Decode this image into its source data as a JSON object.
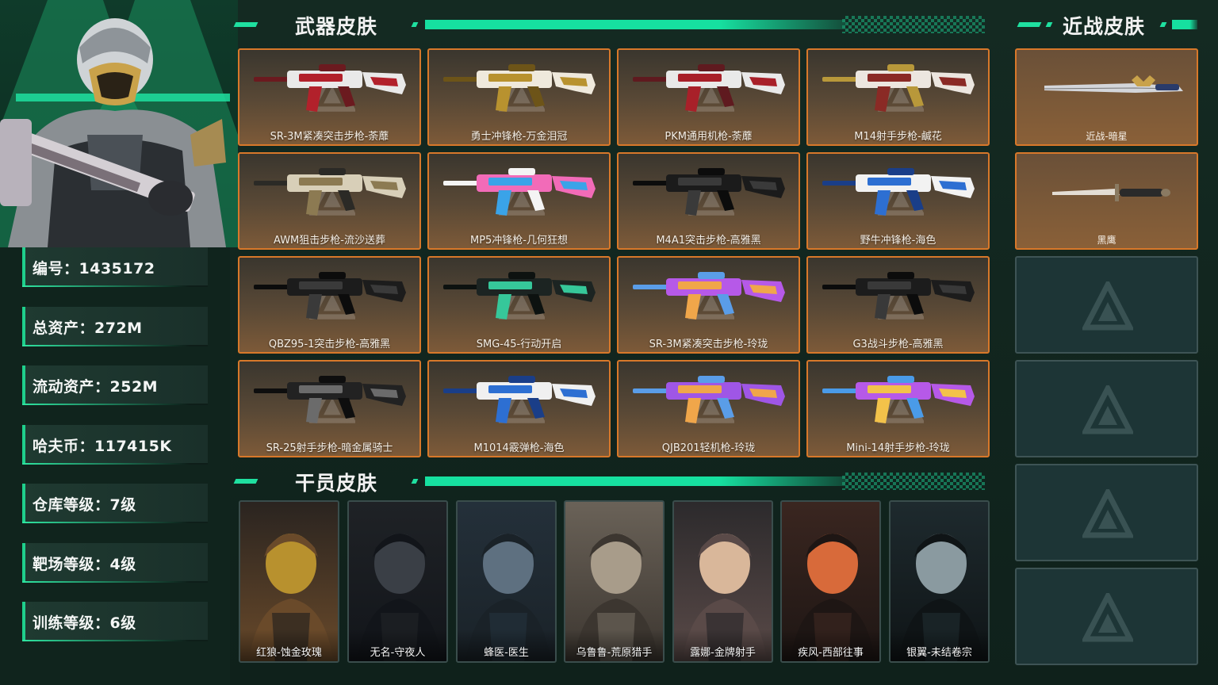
{
  "profile": {
    "stats": [
      {
        "label": "编号：1435172"
      },
      {
        "label": "总资产：272M"
      },
      {
        "label": "流动资产：252M"
      },
      {
        "label": "哈夫币：117415K"
      },
      {
        "label": "仓库等级：7级"
      },
      {
        "label": "靶场等级：4级"
      },
      {
        "label": "训练等级：6级"
      }
    ]
  },
  "sections": {
    "weapons_title": "武器皮肤",
    "operators_title": "干员皮肤",
    "melee_title": "近战皮肤"
  },
  "weapons": [
    {
      "name": "SR-3M紧凑突击步枪-荼蘼",
      "palette": [
        "#e9e9e9",
        "#b2212b",
        "#6b1a1f"
      ]
    },
    {
      "name": "勇士冲锋枪-万金泪冠",
      "palette": [
        "#efe9dc",
        "#b8922f",
        "#6d5418"
      ]
    },
    {
      "name": "PKM通用机枪-荼蘼",
      "palette": [
        "#e9e9e9",
        "#a82029",
        "#5f1a1f"
      ]
    },
    {
      "name": "M14射手步枪-鹹花",
      "palette": [
        "#ece6df",
        "#8a2a25",
        "#b8983a"
      ]
    },
    {
      "name": "AWM狙击步枪-流沙送葬",
      "palette": [
        "#d8cfb8",
        "#8c7a52",
        "#2b2a26"
      ]
    },
    {
      "name": "MP5冲锋枪-几何狂想",
      "palette": [
        "#f26bb8",
        "#3aa3e8",
        "#f4f4f4"
      ]
    },
    {
      "name": "M4A1突击步枪-高雅黑",
      "palette": [
        "#1b1b1b",
        "#3a3a3a",
        "#0c0c0c"
      ]
    },
    {
      "name": "野牛冲锋枪-海色",
      "palette": [
        "#f2f2f2",
        "#2d6fd2",
        "#1a3e88"
      ]
    },
    {
      "name": "QBZ95-1突击步枪-高雅黑",
      "palette": [
        "#1c1c1c",
        "#3a3a3a",
        "#0c0c0c"
      ]
    },
    {
      "name": "SMG-45-行动开启",
      "palette": [
        "#1c2422",
        "#36c79a",
        "#0d1210"
      ]
    },
    {
      "name": "SR-3M紧凑突击步枪-玲珑",
      "palette": [
        "#b659e8",
        "#f0a64a",
        "#5a9de8"
      ]
    },
    {
      "name": "G3战斗步枪-高雅黑",
      "palette": [
        "#1c1c1c",
        "#393939",
        "#0c0c0c"
      ]
    },
    {
      "name": "SR-25射手步枪-暗金属骑士",
      "palette": [
        "#222222",
        "#6b6b6b",
        "#0e0e0e"
      ]
    },
    {
      "name": "M1014霰弹枪-海色",
      "palette": [
        "#f0f0f0",
        "#2d6fd2",
        "#1a3e88"
      ]
    },
    {
      "name": "QJB201轻机枪-玲珑",
      "palette": [
        "#9f56e6",
        "#f0a64a",
        "#5a9de8"
      ]
    },
    {
      "name": "Mini-14射手步枪-玲珑",
      "palette": [
        "#b659e8",
        "#f3c24a",
        "#4a9be8"
      ]
    }
  ],
  "operators": [
    {
      "name": "红狼-蚀金玫瑰",
      "palette": [
        "#2a2420",
        "#b8912e",
        "#6a4a2a"
      ]
    },
    {
      "name": "无名-守夜人",
      "palette": [
        "#1f2226",
        "#3a3f46",
        "#12151a"
      ]
    },
    {
      "name": "蜂医-医生",
      "palette": [
        "#24303a",
        "#5e7080",
        "#1a2228"
      ]
    },
    {
      "name": "乌鲁鲁-荒原猎手",
      "palette": [
        "#6a6258",
        "#a89c8a",
        "#3c3630"
      ]
    },
    {
      "name": "露娜-金牌射手",
      "palette": [
        "#2c2a2c",
        "#d9b79a",
        "#5a4a48"
      ]
    },
    {
      "name": "疾风-西部往事",
      "palette": [
        "#3a2620",
        "#d86a3a",
        "#1e1614"
      ]
    },
    {
      "name": "银翼-未结卷宗",
      "palette": [
        "#1e2a2e",
        "#8a9aa0",
        "#0f1416"
      ]
    }
  ],
  "melee": [
    {
      "name": "近战-暗星"
    },
    {
      "name": "黑鹰"
    }
  ],
  "theme": {
    "accent": "#1fe0a0",
    "card_border": "#d8782a",
    "empty_border": "#3e5455"
  }
}
